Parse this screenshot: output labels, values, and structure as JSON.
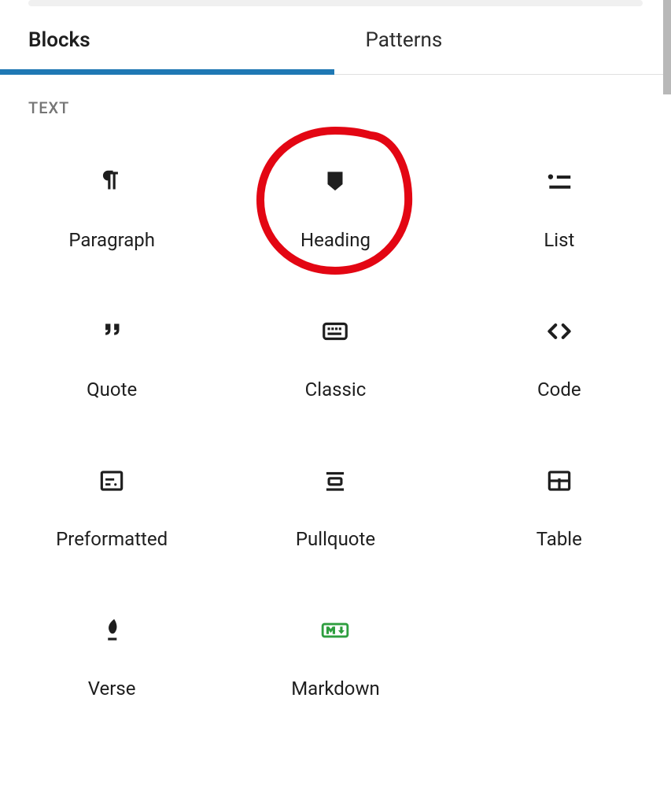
{
  "tabs": {
    "blocks": "Blocks",
    "patterns": "Patterns"
  },
  "category": {
    "text": "TEXT"
  },
  "blocks": {
    "paragraph": "Paragraph",
    "heading": "Heading",
    "list": "List",
    "quote": "Quote",
    "classic": "Classic",
    "code": "Code",
    "preformatted": "Preformatted",
    "pullquote": "Pullquote",
    "table": "Table",
    "verse": "Verse",
    "markdown": "Markdown"
  }
}
